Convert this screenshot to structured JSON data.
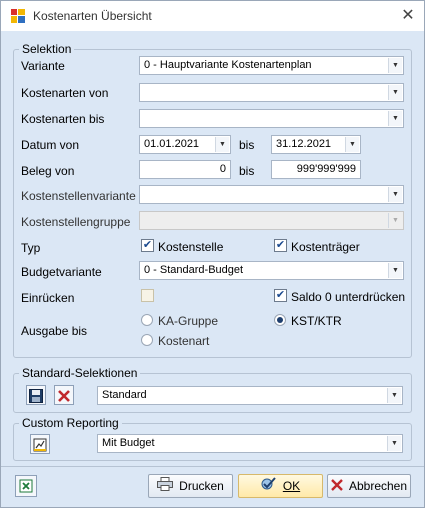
{
  "window": {
    "title": "Kostenarten Übersicht"
  },
  "selektion": {
    "legend": "Selektion",
    "variante": {
      "label": "Variante",
      "value": "0 - Hauptvariante Kostenartenplan"
    },
    "kostenarten_von": {
      "label": "Kostenarten von",
      "value": ""
    },
    "kostenarten_bis": {
      "label": "Kostenarten bis",
      "value": ""
    },
    "datum": {
      "label": "Datum von",
      "from": "01.01.2021",
      "bis_label": "bis",
      "to": "31.12.2021"
    },
    "beleg": {
      "label": "Beleg von",
      "from": "0",
      "bis_label": "bis",
      "to": "999'999'999"
    },
    "kostenstellenvariante": {
      "label": "Kostenstellenvariante",
      "value": ""
    },
    "kostenstellengruppe": {
      "label": "Kostenstellengruppe",
      "value": ""
    },
    "typ": {
      "label": "Typ",
      "kostenstelle": {
        "label": "Kostenstelle",
        "checked": true
      },
      "kostentraeger": {
        "label": "Kostenträger",
        "checked": true
      }
    },
    "budgetvariante": {
      "label": "Budgetvariante",
      "value": "0 - Standard-Budget"
    },
    "einruecken": {
      "label": "Einrücken",
      "checked": false
    },
    "saldo": {
      "label": "Saldo 0 unterdrücken",
      "checked": true
    },
    "ausgabe": {
      "label": "Ausgabe bis",
      "options": [
        {
          "label": "KA-Gruppe",
          "checked": false
        },
        {
          "label": "KST/KTR",
          "checked": true
        },
        {
          "label": "Kostenart",
          "checked": false
        }
      ]
    }
  },
  "standard": {
    "legend": "Standard-Selektionen",
    "value": "Standard"
  },
  "reporting": {
    "legend": "Custom Reporting",
    "value": "Mit Budget"
  },
  "footer": {
    "drucken": "Drucken",
    "ok": "OK",
    "abbrechen": "Abbrechen"
  },
  "colors": {
    "accent": "#1e3f6e",
    "window_bg": "#dbe7f5",
    "ok_bg": "#ffe9a8",
    "delete_red": "#c0282d"
  }
}
